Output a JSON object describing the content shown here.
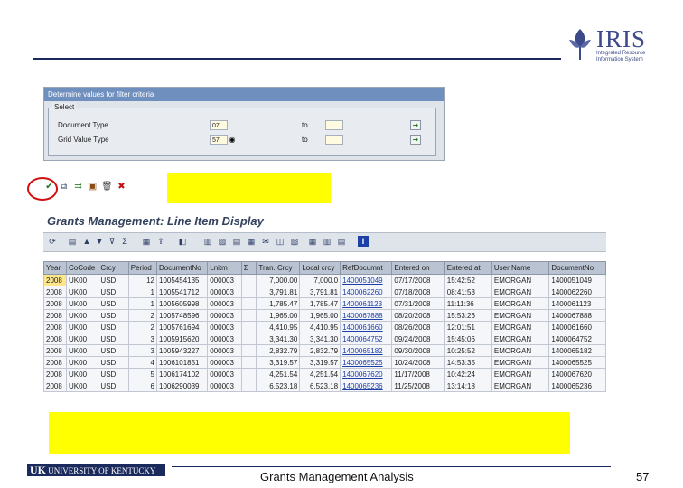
{
  "header": {
    "logo_text": "IRIS",
    "logo_subtitle": "Integrated Resource Information System"
  },
  "dialog": {
    "title": "Determine values for filter criteria",
    "group_label": "Select",
    "rows": [
      {
        "label": "Document Type",
        "value": "07",
        "to": "to"
      },
      {
        "label": "Grid Value Type",
        "value": "57",
        "to": "to"
      }
    ]
  },
  "mini_toolbar": {
    "icons": [
      "execute-check",
      "copy",
      "multiple-selection",
      "save-variant",
      "delete",
      "cancel"
    ]
  },
  "report": {
    "title": "Grants Management: Line Item Display",
    "columns": [
      "Year",
      "CoCode",
      "Crcy",
      "Period",
      "DocumentNo",
      "Lnitm",
      "Σ",
      "Tran. Crcy",
      "Local crcy",
      "RefDocumnt",
      "Entered on",
      "Entered at",
      "User Name",
      "DocumentNo"
    ],
    "rows": [
      [
        "2008",
        "UK00",
        "USD",
        "12",
        "1005454135",
        "000003",
        "",
        "7,000.00",
        "7,000.0",
        "1400051049",
        "07/17/2008",
        "15:42:52",
        "EMORGAN",
        "1400051049"
      ],
      [
        "2008",
        "UK00",
        "USD",
        "1",
        "1005541712",
        "000003",
        "",
        "3,791.81",
        "3,791.81",
        "1400062260",
        "07/18/2008",
        "08:41:53",
        "EMORGAN",
        "1400062260"
      ],
      [
        "2008",
        "UK00",
        "USD",
        "1",
        "1005605998",
        "000003",
        "",
        "1,785.47",
        "1,785.47",
        "1400061123",
        "07/31/2008",
        "11:11:36",
        "EMORGAN",
        "1400061123"
      ],
      [
        "2008",
        "UK00",
        "USD",
        "2",
        "1005748596",
        "000003",
        "",
        "1,965.00",
        "1,965.00",
        "1400067888",
        "08/20/2008",
        "15:53:26",
        "EMORGAN",
        "1400067888"
      ],
      [
        "2008",
        "UK00",
        "USD",
        "2",
        "1005761694",
        "000003",
        "",
        "4,410.95",
        "4,410.95",
        "1400061660",
        "08/26/2008",
        "12:01:51",
        "EMORGAN",
        "1400061660"
      ],
      [
        "2008",
        "UK00",
        "USD",
        "3",
        "1005915620",
        "000003",
        "",
        "3,341.30",
        "3,341.30",
        "1400064752",
        "09/24/2008",
        "15:45:06",
        "EMORGAN",
        "1400064752"
      ],
      [
        "2008",
        "UK00",
        "USD",
        "3",
        "1005943227",
        "000003",
        "",
        "2,832.79",
        "2,832.79",
        "1400065182",
        "09/30/2008",
        "10:25:52",
        "EMORGAN",
        "1400065182"
      ],
      [
        "2008",
        "UK00",
        "USD",
        "4",
        "1006101851",
        "000003",
        "",
        "3,319.57",
        "3,319.57",
        "1400065525",
        "10/24/2008",
        "14:53:35",
        "EMORGAN",
        "1400065525"
      ],
      [
        "2008",
        "UK00",
        "USD",
        "5",
        "1006174102",
        "000003",
        "",
        "4,251.54",
        "4,251.54",
        "1400067620",
        "11/17/2008",
        "10:42:24",
        "EMORGAN",
        "1400067620"
      ],
      [
        "2008",
        "UK00",
        "USD",
        "6",
        "1006290039",
        "000003",
        "",
        "6,523.18",
        "6,523.18",
        "1400065236",
        "11/25/2008",
        "13:14:18",
        "EMORGAN",
        "1400065236"
      ]
    ]
  },
  "footer": {
    "uk_prefix": "UK",
    "uk_text": "UNIVERSITY OF KENTUCKY",
    "title": "Grants Management Analysis",
    "page_number": "57"
  },
  "colors": {
    "highlight": "#ffff00",
    "annotation_circle": "#d01010",
    "navy": "#1b2a5c"
  }
}
